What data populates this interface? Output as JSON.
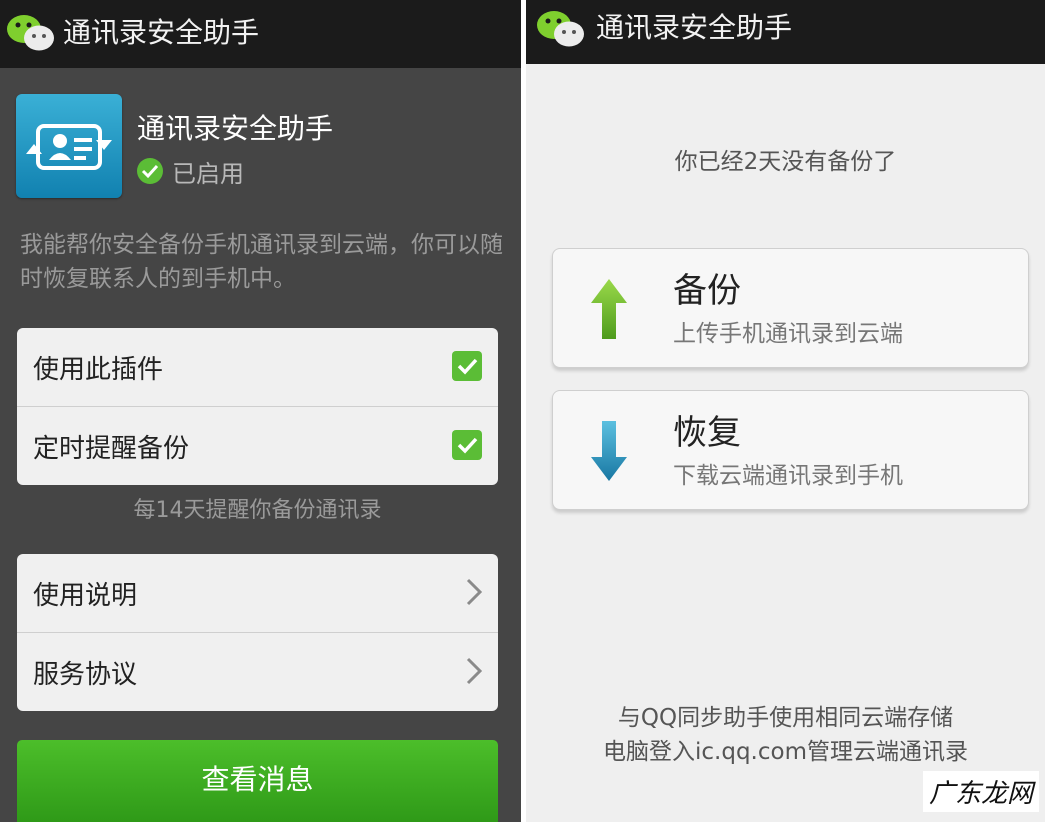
{
  "left": {
    "title": "通讯录安全助手",
    "plugin_name": "通讯录安全助手",
    "status": "已启用",
    "description": "我能帮你安全备份手机通讯录到云端，你可以随时恢复联系人的到手机中。",
    "settings": [
      {
        "label": "使用此插件",
        "checked": true
      },
      {
        "label": "定时提醒备份",
        "checked": true
      }
    ],
    "reminder_note": "每14天提醒你备份通讯录",
    "links": [
      {
        "label": "使用说明"
      },
      {
        "label": "服务协议"
      }
    ],
    "view_button": "查看消息"
  },
  "right": {
    "title": "通讯录安全助手",
    "last_backup": "你已经2天没有备份了",
    "backup": {
      "title": "备份",
      "subtitle": "上传手机通讯录到云端",
      "icon": "arrow-up-icon"
    },
    "restore": {
      "title": "恢复",
      "subtitle": "下载云端通讯录到手机",
      "icon": "arrow-down-icon"
    },
    "footer_line1": "与QQ同步助手使用相同云端存储",
    "footer_line2": "电脑登入ic.qq.com管理云端通讯录"
  },
  "watermark": "广东龙网",
  "colors": {
    "accent_green": "#3faf22",
    "check_green": "#5bbd36",
    "titlebar": "#1b1b1b",
    "left_bg": "#454545"
  }
}
